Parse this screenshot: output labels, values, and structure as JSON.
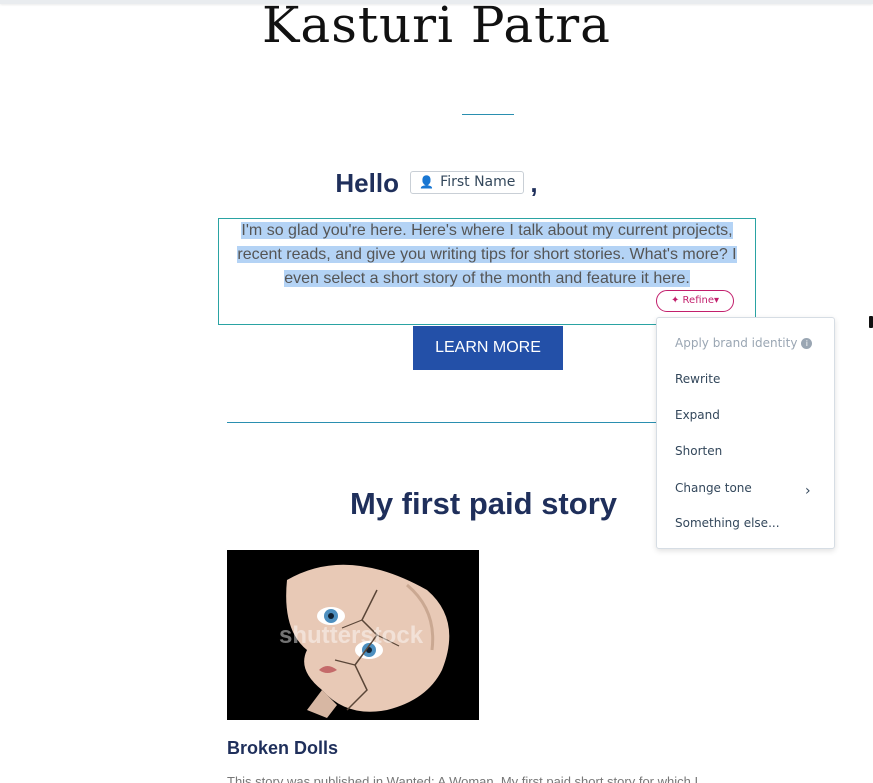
{
  "header": {
    "brand": "Kasturi Patra"
  },
  "greeting": {
    "hello": "Hello",
    "token_label": "First Name",
    "comma": ","
  },
  "intro": {
    "text": "I'm so glad you're here. Here's where I talk about my current projects, recent reads, and give you writing tips for short stories. What's more? I even select a short story of the month and feature it here.",
    "selected": true
  },
  "refine_button": {
    "label": "✦ Refine▾"
  },
  "cta": {
    "label": "LEARN MORE"
  },
  "section": {
    "title": "My first paid story"
  },
  "story": {
    "image_watermark": "shutterstock",
    "title": "Broken Dolls",
    "teaser": "This story was published in Wanted: A Woman. My first paid short story for which I"
  },
  "refine_menu": {
    "items": [
      {
        "label": "Apply brand identity",
        "disabled": true
      },
      {
        "label": "Rewrite"
      },
      {
        "label": "Expand"
      },
      {
        "label": "Shorten"
      },
      {
        "label": "Change tone"
      },
      {
        "label": "Something else..."
      }
    ]
  },
  "icons": {
    "person": "person-icon",
    "info": "info-icon",
    "chevron": "chevron-right-icon",
    "sparkle": "sparkle-icon"
  },
  "colors": {
    "heading": "#1f2f5b",
    "accent_button": "#2350a8",
    "refine_pink": "#c21f6c",
    "selection": "#b4d3f5",
    "rule": "#2a8fb0"
  }
}
